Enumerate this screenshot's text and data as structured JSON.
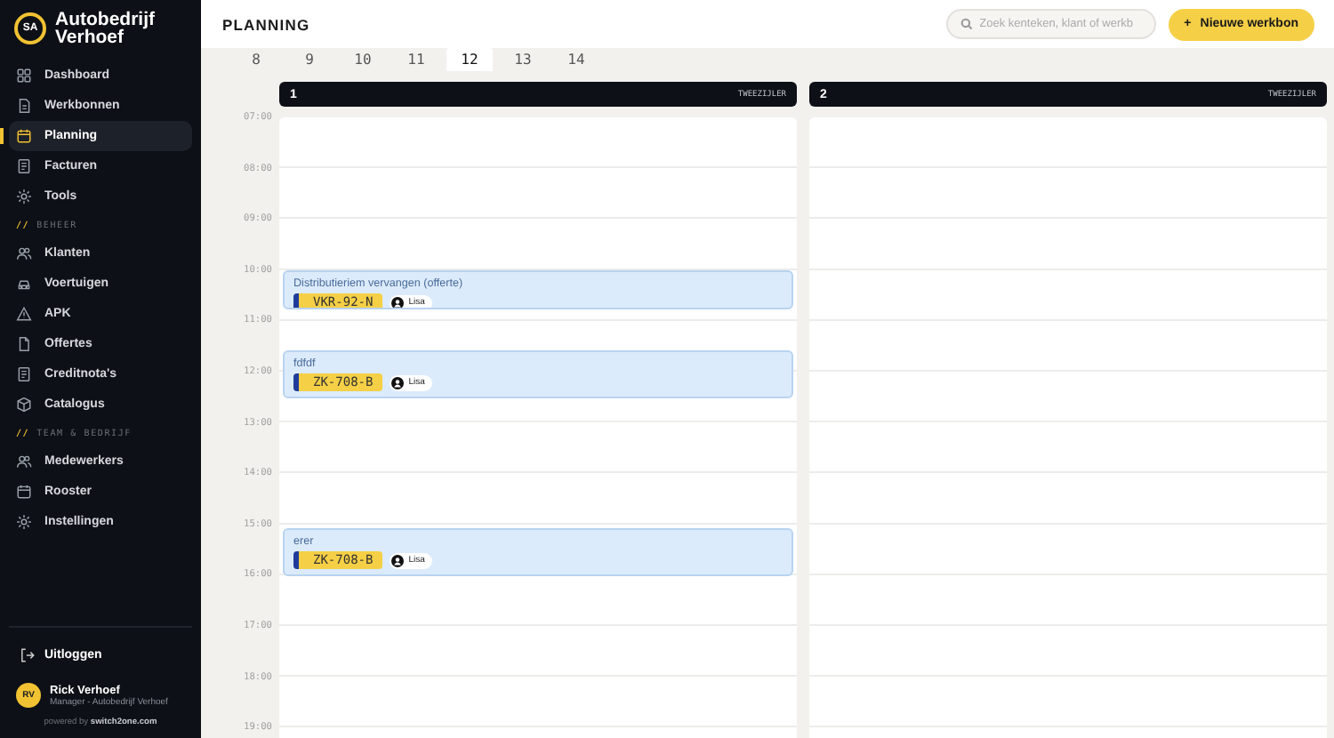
{
  "brand": {
    "logo": "SA",
    "name": "Autobedrijf Verhoef"
  },
  "nav": [
    {
      "kind": "item",
      "label": "Dashboard",
      "selected": false
    },
    {
      "kind": "item",
      "label": "Werkbonnen",
      "selected": false
    },
    {
      "kind": "item",
      "label": "Planning",
      "selected": true
    },
    {
      "kind": "item",
      "label": "Facturen",
      "selected": false
    },
    {
      "kind": "item",
      "label": "Tools",
      "selected": false
    },
    {
      "kind": "section",
      "marker": "//",
      "label": "BEHEER"
    },
    {
      "kind": "item",
      "label": "Klanten",
      "selected": false
    },
    {
      "kind": "item",
      "label": "Voertuigen",
      "selected": false
    },
    {
      "kind": "item",
      "label": "APK",
      "selected": false
    },
    {
      "kind": "item",
      "label": "Offertes",
      "selected": false
    },
    {
      "kind": "item",
      "label": "Creditnota's",
      "selected": false
    },
    {
      "kind": "item",
      "label": "Catalogus",
      "selected": false
    },
    {
      "kind": "section",
      "marker": "//",
      "label": "TEAM & BEDRIJF"
    },
    {
      "kind": "item",
      "label": "Medewerkers",
      "selected": false
    },
    {
      "kind": "item",
      "label": "Rooster",
      "selected": false
    },
    {
      "kind": "item",
      "label": "Instellingen",
      "selected": false
    }
  ],
  "logout": "Uitloggen",
  "user": {
    "initials": "RV",
    "name": "Rick Verhoef",
    "role": "Manager - Autobedrijf Verhoef"
  },
  "powered": "powered by **switch2one.com**",
  "page_title": "PLANNING",
  "search": {
    "placeholder": "Zoek kenteken, klant of werkb"
  },
  "new_button": {
    "icon": "+",
    "label": "Nieuwe werkbon"
  },
  "days": [
    {
      "label": "8",
      "selected": false
    },
    {
      "label": "9",
      "selected": false
    },
    {
      "label": "10",
      "selected": false
    },
    {
      "label": "11",
      "selected": false
    },
    {
      "label": "12",
      "selected": true
    },
    {
      "label": "13",
      "selected": false
    },
    {
      "label": "14",
      "selected": false
    }
  ],
  "hours": [
    "07:00",
    "08:00",
    "09:00",
    "10:00",
    "11:00",
    "12:00",
    "13:00",
    "14:00",
    "15:00",
    "16:00",
    "17:00",
    "18:00",
    "19:00"
  ],
  "columns": [
    {
      "number": "1",
      "type": "TWEEZIJLER",
      "events": [
        {
          "title": "Distributieriem vervangen (offerte)",
          "plate": "VKR-92-N",
          "mechanic": "Lisa"
        },
        {
          "title": "fdfdf",
          "plate": "ZK-708-B",
          "mechanic": "Lisa"
        },
        {
          "title": "erer",
          "plate": "ZK-708-B",
          "mechanic": "Lisa"
        }
      ]
    },
    {
      "number": "2",
      "type": "TWEEZIJLER"
    }
  ]
}
